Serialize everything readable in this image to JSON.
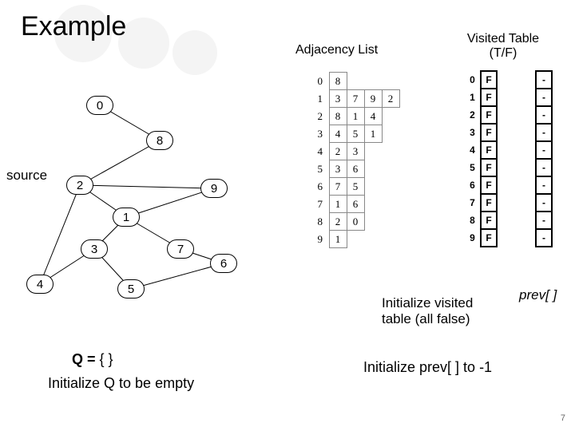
{
  "title": "Example",
  "headers": {
    "adj": "Adjacency List",
    "vt_l1": "Visited Table",
    "vt_l2": "(T/F)"
  },
  "source_label": "source",
  "graph": {
    "nodes": {
      "n0": "0",
      "n1": "1",
      "n2": "2",
      "n3": "3",
      "n4": "4",
      "n5": "5",
      "n6": "6",
      "n7": "7",
      "n8": "8",
      "n9": "9"
    }
  },
  "adj": {
    "rows": [
      {
        "i": "0",
        "c": [
          "8",
          "",
          "",
          ""
        ]
      },
      {
        "i": "1",
        "c": [
          "3",
          "7",
          "9",
          "2"
        ]
      },
      {
        "i": "2",
        "c": [
          "8",
          "1",
          "4",
          ""
        ]
      },
      {
        "i": "3",
        "c": [
          "4",
          "5",
          "1",
          ""
        ]
      },
      {
        "i": "4",
        "c": [
          "2",
          "3",
          "",
          ""
        ]
      },
      {
        "i": "5",
        "c": [
          "3",
          "6",
          "",
          ""
        ]
      },
      {
        "i": "6",
        "c": [
          "7",
          "5",
          "",
          ""
        ]
      },
      {
        "i": "7",
        "c": [
          "1",
          "6",
          "",
          ""
        ]
      },
      {
        "i": "8",
        "c": [
          "2",
          "0",
          "",
          ""
        ]
      },
      {
        "i": "9",
        "c": [
          "1",
          "",
          "",
          ""
        ]
      }
    ]
  },
  "vt": {
    "rows": [
      {
        "i": "0",
        "v": "F"
      },
      {
        "i": "1",
        "v": "F"
      },
      {
        "i": "2",
        "v": "F"
      },
      {
        "i": "3",
        "v": "F"
      },
      {
        "i": "4",
        "v": "F"
      },
      {
        "i": "5",
        "v": "F"
      },
      {
        "i": "6",
        "v": "F"
      },
      {
        "i": "7",
        "v": "F"
      },
      {
        "i": "8",
        "v": "F"
      },
      {
        "i": "9",
        "v": "F"
      }
    ]
  },
  "prev": {
    "rows": [
      "-",
      "-",
      "-",
      "-",
      "-",
      "-",
      "-",
      "-",
      "-",
      "-"
    ]
  },
  "annotations": {
    "init_visited_l1": "Initialize visited",
    "init_visited_l2": "table (all false)",
    "prev_label": "prev[ ]",
    "q_eq": "Q =",
    "q_set": " {    }",
    "init_q": "Initialize Q to be empty",
    "init_prev": "Initialize prev[ ] to -1"
  },
  "page": "7"
}
